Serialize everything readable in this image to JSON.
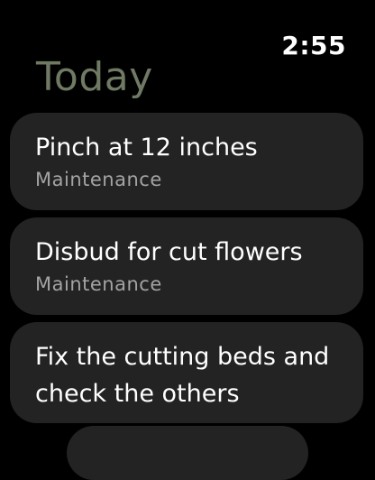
{
  "status": {
    "time": "2:55"
  },
  "header": {
    "title": "Today"
  },
  "tasks": [
    {
      "title": "Pinch at 12 inches",
      "subtitle": "Maintenance"
    },
    {
      "title": "Disbud for cut flowers",
      "subtitle": "Maintenance"
    },
    {
      "title": "Fix the cutting beds and check the others"
    }
  ],
  "colors": {
    "background": "#000000",
    "card": "#232323",
    "title_accent": "#6f7a63",
    "subtitle": "#a3a3a3"
  }
}
